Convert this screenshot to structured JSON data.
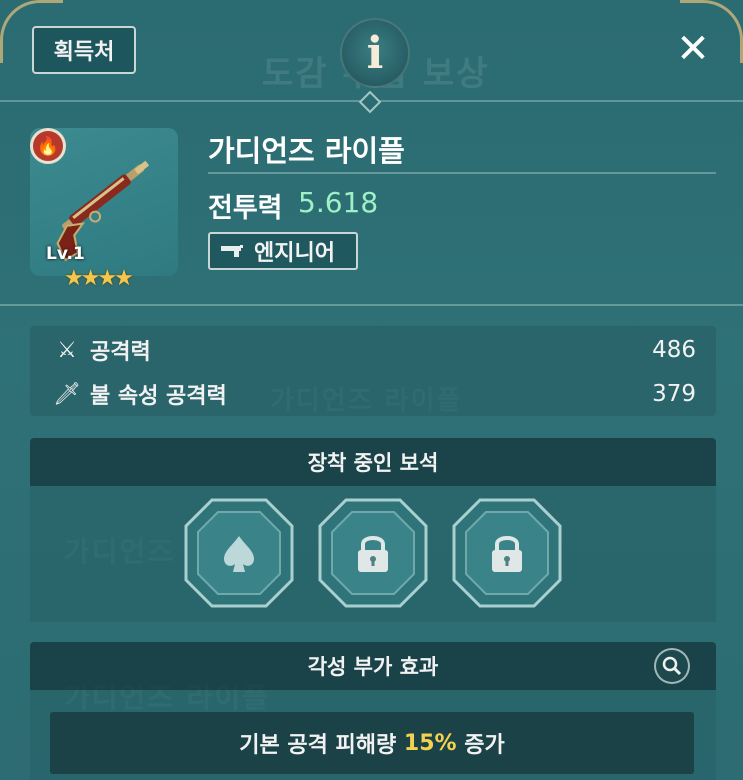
{
  "header": {
    "source_button_label": "획득처",
    "info_icon_glyph": "i",
    "close_icon_glyph": "✕"
  },
  "item": {
    "name": "가디언즈 라이플",
    "level": "Lv.1",
    "stars": "★★★★",
    "element_icon": "fire-element-icon",
    "combat_power_label": "전투력",
    "combat_power_value": "5.618",
    "class_icon": "gun-icon",
    "class_label": "엔지니어"
  },
  "stats": [
    {
      "icon": "crossed-swords-icon",
      "label": "공격력",
      "value": "486"
    },
    {
      "icon": "fire-sword-icon",
      "label": "불 속성 공격력",
      "value": "379"
    }
  ],
  "gems": {
    "title": "장착 중인 보석",
    "slots": [
      {
        "state": "empty",
        "icon": "spade-icon"
      },
      {
        "state": "locked",
        "icon": "lock-icon"
      },
      {
        "state": "locked",
        "icon": "lock-icon"
      }
    ]
  },
  "awakening": {
    "title": "각성 부가 효과",
    "search_icon": "search-icon",
    "effect_prefix": "기본 공격 피해량 ",
    "effect_value": "15%",
    "effect_suffix": " 증가"
  },
  "colors": {
    "power_value": "#9ff0c4",
    "highlight": "#f3d24f",
    "star": "#f3c64d",
    "panel": "#2e7176"
  }
}
